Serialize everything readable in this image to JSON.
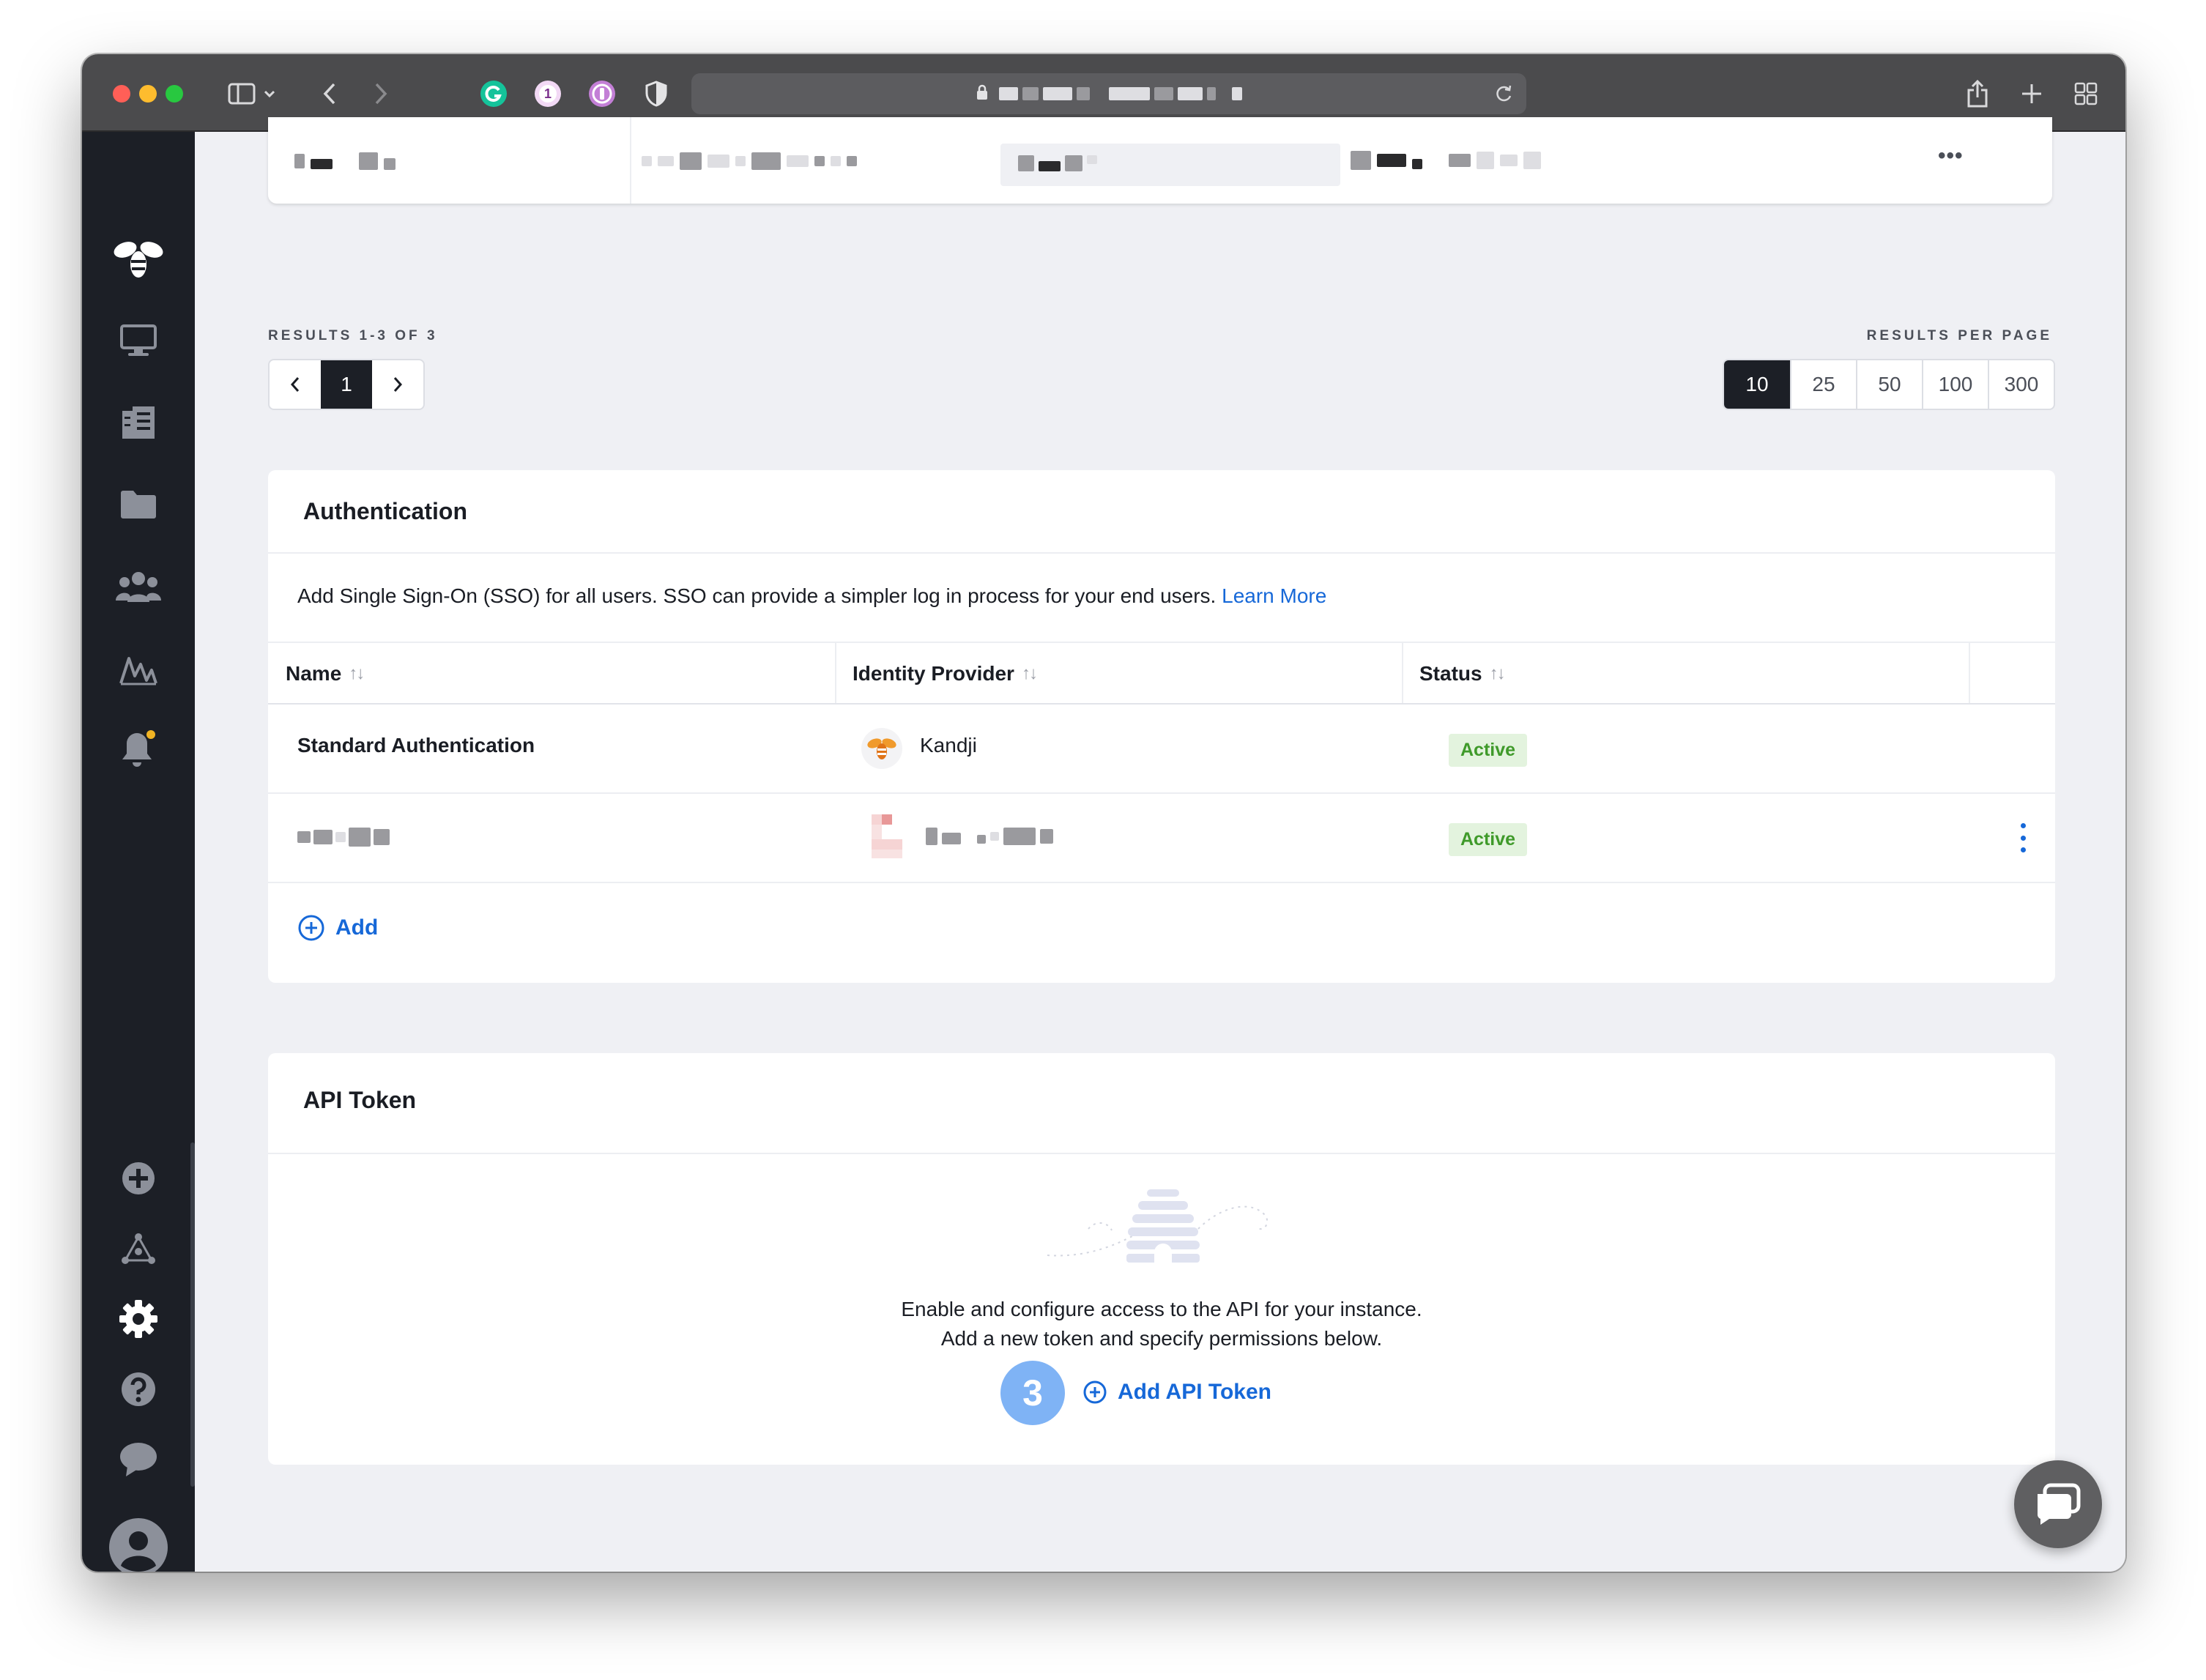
{
  "browser": {
    "toolbar_icons": [
      "sidebar-toggle-icon",
      "back-icon",
      "forward-icon",
      "grammarly-icon",
      "onepassword-icon",
      "extension-icon",
      "privacy-shield-icon",
      "share-icon",
      "new-tab-icon",
      "tab-overview-icon"
    ],
    "onepassword_badge": "1"
  },
  "sidebar": {
    "items": [
      "devices-icon",
      "library-icon",
      "blueprints-folder-icon",
      "users-icon",
      "activity-icon",
      "alerts-bell-icon",
      "add-device-icon",
      "integrations-icon",
      "settings-gear-icon",
      "help-icon",
      "chat-icon",
      "user-avatar-icon"
    ]
  },
  "top_table": {
    "row_menu": "•••"
  },
  "pagination": {
    "results_label": "RESULTS 1-3 OF 3",
    "current_page": "1",
    "per_page_label": "RESULTS PER PAGE",
    "per_page_options": [
      "10",
      "25",
      "50",
      "100",
      "300"
    ],
    "per_page_selected": "10"
  },
  "authentication": {
    "title": "Authentication",
    "description": "Add Single Sign-On (SSO) for all users. SSO can provide a simpler log in process for your end users.",
    "learn_more": "Learn More",
    "columns": {
      "name": "Name",
      "identity_provider": "Identity Provider",
      "status": "Status"
    },
    "rows": [
      {
        "name": "Standard Authentication",
        "provider": "Kandji",
        "status": "Active"
      },
      {
        "status": "Active"
      }
    ],
    "add_label": "Add"
  },
  "api_token": {
    "title": "API Token",
    "empty_line1": "Enable and configure access to the API for your instance.",
    "empty_line2": "Add a new token and specify permissions below.",
    "step_number": "3",
    "add_label": "Add API Token"
  },
  "colors": {
    "sidebar_bg": "#1c1f26",
    "page_bg": "#eff0f4",
    "accent_link": "#1668d8",
    "active_badge_bg": "#e3f3de",
    "active_badge_text": "#3f9a2a",
    "step_badge": "#7fb3f5"
  }
}
